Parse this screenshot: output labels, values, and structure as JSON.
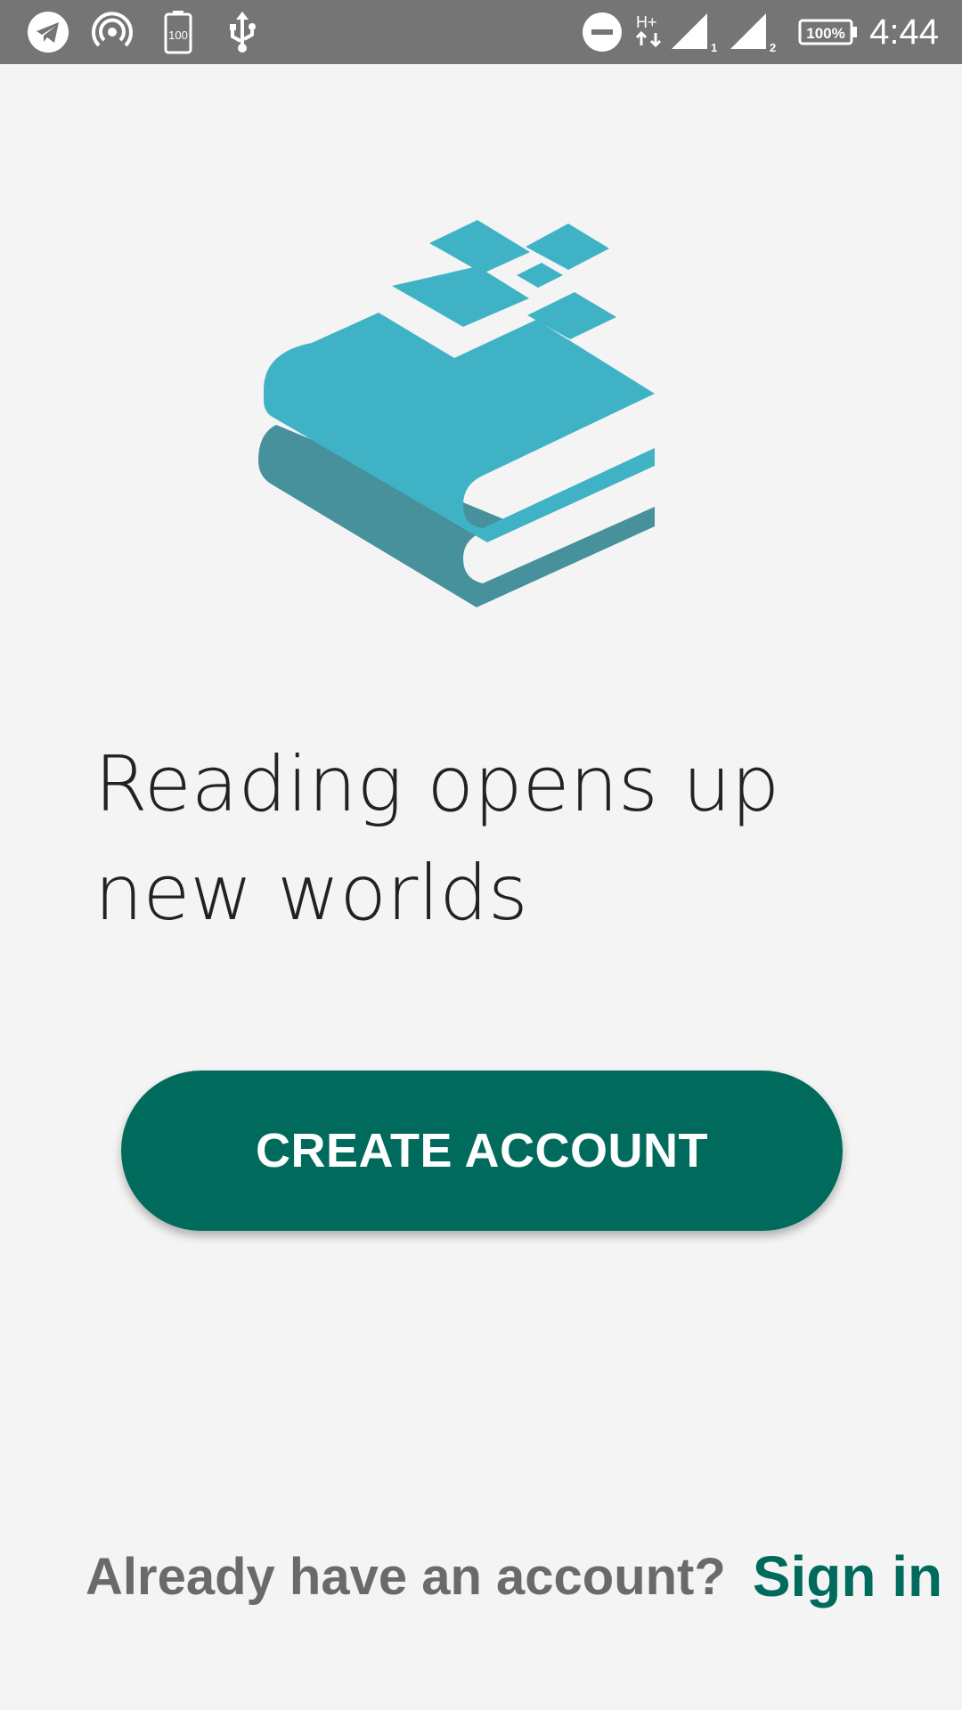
{
  "status_bar": {
    "time": "4:44",
    "battery_percent": "100%",
    "battery_saver_level": "100",
    "network_type": "H+",
    "sim1_label": "1",
    "sim2_label": "2",
    "icons": [
      "telegram-icon",
      "hotspot-icon",
      "battery-saver-icon",
      "usb-icon",
      "do-not-disturb-icon",
      "network-type-icon",
      "signal-sim1-icon",
      "signal-sim2-icon",
      "battery-icon"
    ]
  },
  "illustration": {
    "icon": "books-pixel-logo",
    "colors": {
      "primary": "#3fb3c5",
      "secondary": "#47919d"
    }
  },
  "headline": {
    "line1": "Reading opens up",
    "line2": "new worlds"
  },
  "create_account": {
    "label": "CREATE ACCOUNT",
    "color": "#006b5c"
  },
  "footer": {
    "question": "Already have an account?",
    "signin_label": "Sign in",
    "link_color": "#006b5c"
  }
}
